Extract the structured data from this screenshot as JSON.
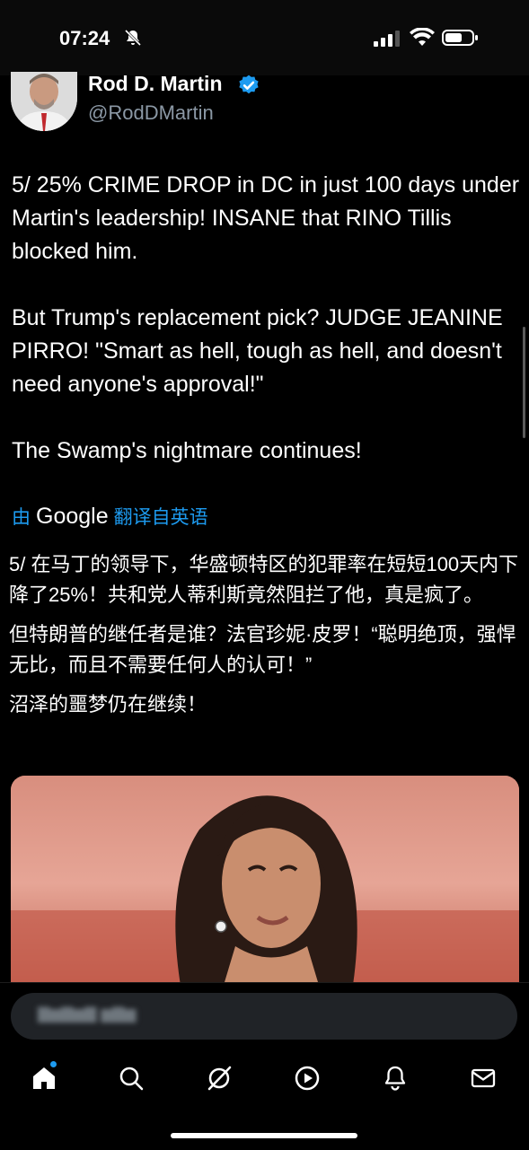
{
  "status_bar": {
    "time": "07:24",
    "icons": [
      "bell-muted-icon",
      "cellular-signal-icon",
      "wifi-icon",
      "battery-icon"
    ]
  },
  "tweet": {
    "author_name": "Rod D. Martin",
    "author_handle": "@RodDMartin",
    "verified": true,
    "paragraphs": [
      "5/ 25% CRIME DROP in DC in just 100 days under Martin's leadership! INSANE that RINO Tillis blocked him.",
      "But Trump's replacement pick? JUDGE JEANINE PIRRO!  \"Smart as hell, tough as hell, and doesn't need anyone's approval!\"",
      "The Swamp's nightmare continues!"
    ]
  },
  "translation": {
    "prefix": "由",
    "provider": "Google",
    "suffix": "翻译自英语",
    "paragraphs": [
      "5/ 在马丁的领导下，华盛顿特区的犯罪率在短短100天内下降了25%！共和党人蒂利斯竟然阻拦了他，真是疯了。",
      "但特朗普的继任者是谁？法官珍妮·皮罗！“聪明绝顶，强悍无比，而且不需要任何人的认可！”",
      "沼泽的噩梦仍在继续！"
    ]
  },
  "bottom_nav": {
    "items": [
      "home-icon",
      "search-icon",
      "grok-icon",
      "video-icon",
      "notifications-icon",
      "messages-icon"
    ],
    "accent": "#1d9bf0"
  },
  "colors": {
    "background": "#000000",
    "text": "#ffffff",
    "secondary_text": "#8b98a5",
    "link": "#1d9bf0"
  }
}
